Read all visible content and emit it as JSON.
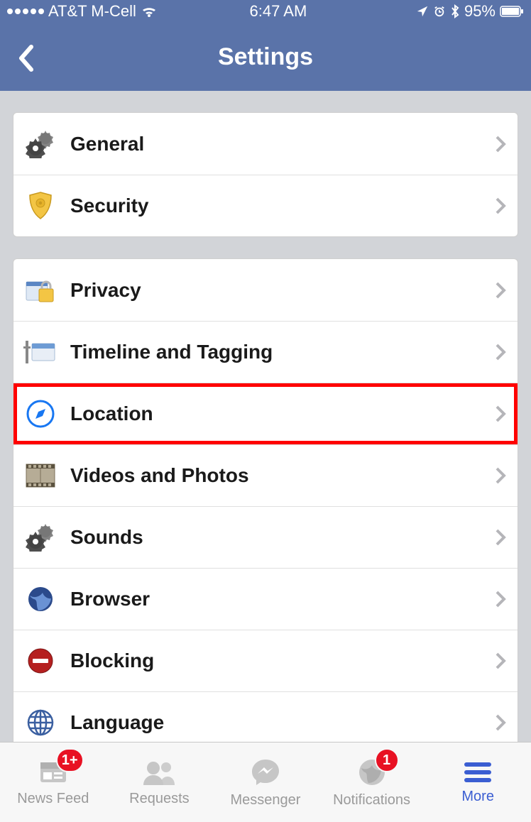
{
  "statusbar": {
    "carrier": "AT&T M-Cell",
    "time": "6:47 AM",
    "battery": "95%"
  },
  "nav": {
    "title": "Settings"
  },
  "groups": [
    {
      "items": [
        {
          "id": "general",
          "label": "General"
        },
        {
          "id": "security",
          "label": "Security"
        }
      ]
    },
    {
      "items": [
        {
          "id": "privacy",
          "label": "Privacy"
        },
        {
          "id": "timeline",
          "label": "Timeline and Tagging"
        },
        {
          "id": "location",
          "label": "Location",
          "highlighted": true
        },
        {
          "id": "videos",
          "label": "Videos and Photos"
        },
        {
          "id": "sounds",
          "label": "Sounds"
        },
        {
          "id": "browser",
          "label": "Browser"
        },
        {
          "id": "blocking",
          "label": "Blocking"
        },
        {
          "id": "language",
          "label": "Language"
        }
      ]
    }
  ],
  "tabs": [
    {
      "id": "newsfeed",
      "label": "News Feed",
      "badge": "1+"
    },
    {
      "id": "requests",
      "label": "Requests"
    },
    {
      "id": "messenger",
      "label": "Messenger"
    },
    {
      "id": "notifications",
      "label": "Notifications",
      "badge": "1"
    },
    {
      "id": "more",
      "label": "More",
      "active": true
    }
  ]
}
